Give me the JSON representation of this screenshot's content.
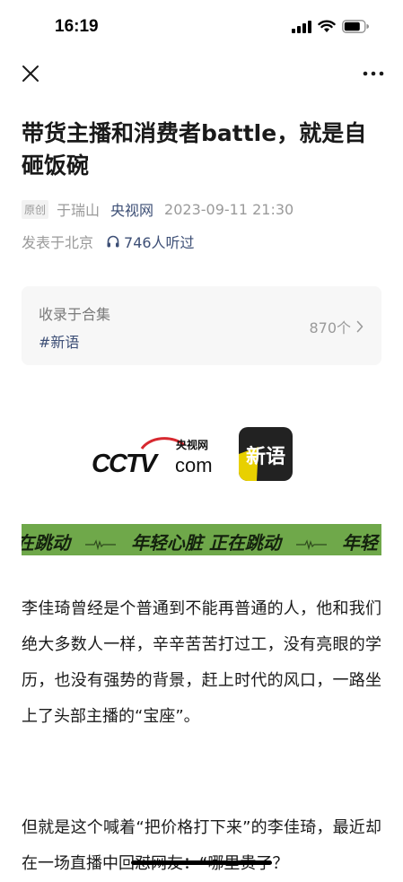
{
  "status_bar": {
    "time": "16:19"
  },
  "nav": {
    "close_icon": "close-icon",
    "more_icon": "more-icon"
  },
  "article": {
    "title": "带货主播和消费者battle，就是自砸饭碗",
    "badge": "原创",
    "author": "于瑞山",
    "source": "央视网",
    "datetime": "2023-09-11 21:30",
    "location": "发表于北京",
    "listeners": "746人听过"
  },
  "collection": {
    "label": "收录于合集",
    "tag": "#新语",
    "count": "870个"
  },
  "logos": {
    "cctv_text": "CCTV",
    "cctv_sub": "央视网",
    "cctv_domain": "com",
    "xinyu": "新语"
  },
  "banner": {
    "segments": [
      "在跳动",
      "年轻心脏 正在跳动",
      "年轻"
    ]
  },
  "body": {
    "paragraphs": [
      "李佳琦曾经是个普通到不能再普通的人，他和我们绝大多数人一样，辛辛苦苦打过工，没有亮眼的学历，也没有强势的背景，赶上时代的风口，一路坐上了头部主播的“宝座”。",
      "但就是这个喊着“把价格打下来”的李佳琦，最近却在一场直播中回怼网友：“哪里贵了？"
    ]
  },
  "colors": {
    "link": "#3d4f76",
    "banner_green": "#6fa84a",
    "cctv_red": "#d7282f"
  }
}
